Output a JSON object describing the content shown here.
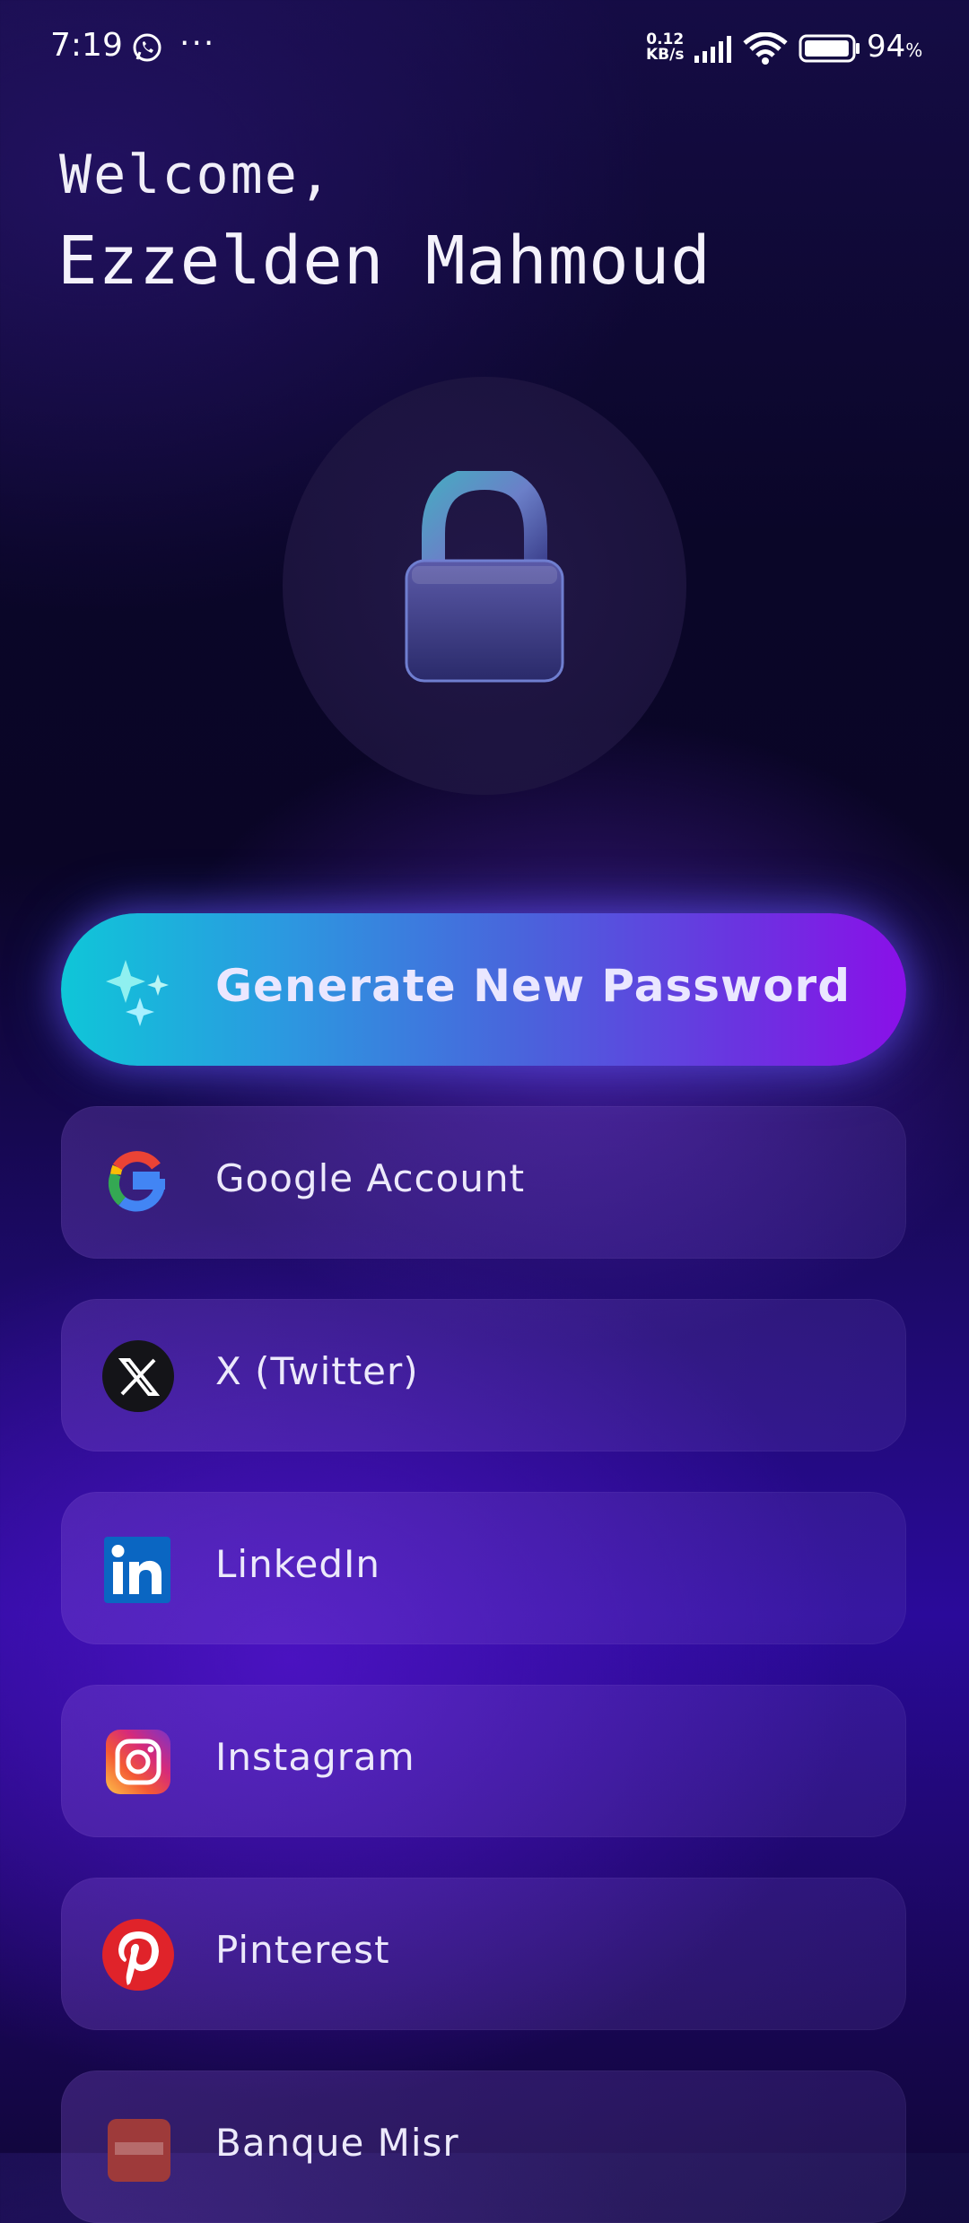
{
  "status_bar": {
    "time": "7:19",
    "notif_more": "···",
    "net_speed_value": "0.12",
    "net_speed_unit": "KB/s",
    "battery_percent": "94",
    "battery_suffix": "%",
    "battery_level": 0.94
  },
  "header": {
    "welcome": "Welcome,",
    "user_name": "Ezzelden Mahmoud"
  },
  "hero": {
    "icon": "lock-icon"
  },
  "generate_button": {
    "label": "Generate New Password",
    "icon": "sparkles-icon"
  },
  "accounts": [
    {
      "label": "Google Account",
      "icon": "google-icon"
    },
    {
      "label": "X (Twitter)",
      "icon": "x-twitter-icon"
    },
    {
      "label": "LinkedIn",
      "icon": "linkedin-icon"
    },
    {
      "label": "Instagram",
      "icon": "instagram-icon"
    },
    {
      "label": "Pinterest",
      "icon": "pinterest-icon"
    },
    {
      "label": "Banque Misr",
      "icon": "banque-misr-icon"
    }
  ],
  "colors": {
    "button_start": "#0fc6d8",
    "button_end": "#8a10e8",
    "background_dark": "#0a0526",
    "background_purple": "#2a0a9a"
  }
}
